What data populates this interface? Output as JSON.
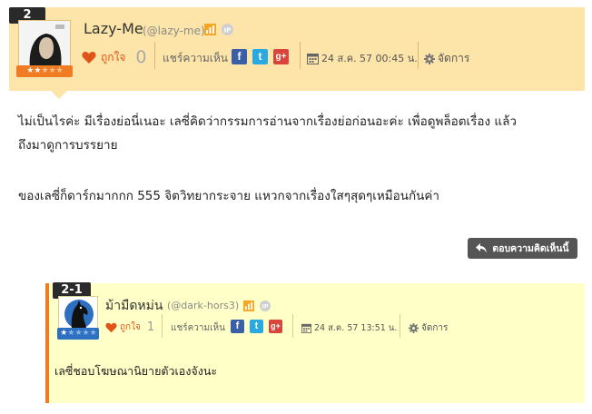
{
  "comment_main": {
    "number": "2",
    "username": "Lazy-Me",
    "handle": "(@lazy-me)",
    "rank_stars_filled": 2,
    "rank_stars_total": 5,
    "like_label": "ถูกใจ",
    "like_count": "0",
    "share_label": "แชร์ความเห็น",
    "share_icons": [
      "facebook-icon",
      "twitter-icon",
      "google-plus-icon"
    ],
    "date": "24 ส.ค. 57 00:45 น.",
    "manage_label": "จัดการ",
    "body_line1": "ไม่เป็นไรค่ะ มีเรื่องย่อนี่เนอะ เลซี่คิดว่ากรรมการอ่านจากเรื่องย่อก่อนอะค่ะ เพื่อดูพล็อตเรื่อง แล้ว",
    "body_line2": "ถึงมาดูการบรรยาย",
    "body_line3": "ของเลซี่ก็ดาร์กมากกก 555 จิตวิทยากระจาย แหวกจากเรื่องใสๆสุดๆเหมือนกันค่า",
    "reply_button": "ตอบความคิดเห็นนี้"
  },
  "comment_reply": {
    "number": "2-1",
    "username": "ม้ามืดหม่น",
    "handle": "(@dark-hors3)",
    "rank_stars_filled": 1,
    "rank_stars_total": 5,
    "like_label": "ถูกใจ",
    "like_count": "1",
    "share_label": "แชร์ความเห็น",
    "date": "24 ส.ค. 57 13:51 น.",
    "manage_label": "จัดการ",
    "body": "เลซี่ชอบโฆษณานิยายตัวเองจังนะ"
  },
  "colors": {
    "header_bg": "#fde5a9",
    "reply_bg": "#ffffc8",
    "accent_orange": "#f07b22",
    "like_red": "#e0541a"
  }
}
